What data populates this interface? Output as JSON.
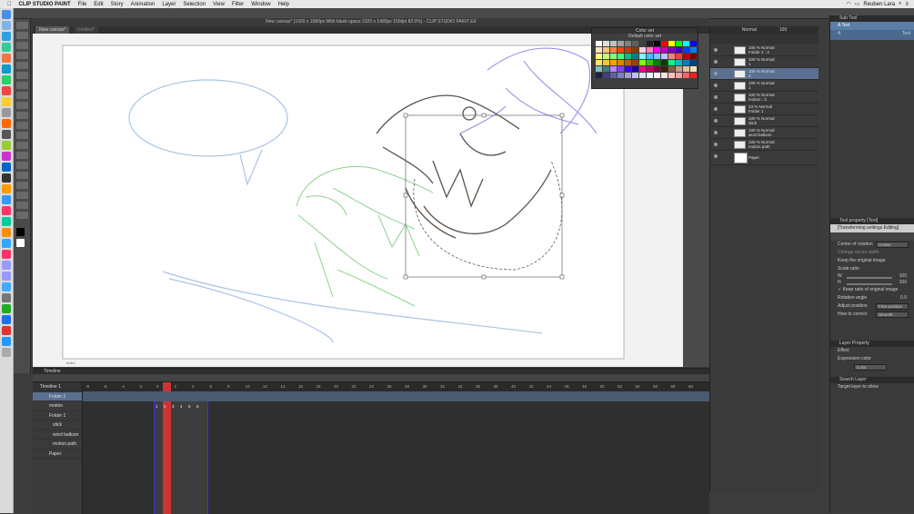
{
  "menubar": {
    "app_name": "CLIP STUDIO PAINT",
    "items": [
      "File",
      "Edit",
      "Story",
      "Animation",
      "Layer",
      "Selection",
      "View",
      "Filter",
      "Window",
      "Help"
    ],
    "user": "Reuben Lara"
  },
  "window": {
    "title": "New canvas* (1920 x 1080px With blank space 2320 x 1480px 150dpi 82.0%)  - CLIP STUDIO PAINT EX",
    "tabs": [
      "New canvas*",
      "Untitled*"
    ]
  },
  "color_set": {
    "title": "Color set",
    "set_name": "Default color set"
  },
  "layers": {
    "blend_mode": "Normal",
    "opacity": "100",
    "rows": [
      {
        "line1": "100 % Normal",
        "line2": "Folder 2 : 3",
        "selected": false
      },
      {
        "line1": "100 % Normal",
        "line2": "1",
        "selected": false
      },
      {
        "line1": "100 % Normal",
        "line2": "3",
        "selected": true
      },
      {
        "line1": "100 % Normal",
        "line2": "1",
        "selected": false
      },
      {
        "line1": "100 % Normal",
        "line2": "motion : 3",
        "selected": false
      },
      {
        "line1": "43 % Normal",
        "line2": "Folder 1",
        "selected": false
      },
      {
        "line1": "100 % Normal",
        "line2": "stick",
        "selected": false
      },
      {
        "line1": "100 % Normal",
        "line2": "word balloon",
        "selected": false
      },
      {
        "line1": "100 % Normal",
        "line2": "motion path",
        "selected": false
      },
      {
        "line1": "",
        "line2": "Paper",
        "selected": false
      }
    ]
  },
  "sub_tool": {
    "header": "Sub Tool",
    "items": [
      "Text"
    ],
    "item2": "Text"
  },
  "tool_property": {
    "header": "Tool property [Text]",
    "mode": "[Transforming settings Editing]",
    "center_of_rotation_label": "Center of rotation",
    "center_of_rotation_value": "Center",
    "change_vector_width": "Change vector width",
    "keep_original_image": "Keep the original image",
    "scale_ratio_label": "Scale ratio",
    "w_label": "W",
    "w_value": "100",
    "h_label": "H",
    "h_value": "100",
    "keep_ratio": "Keep ratio of original image",
    "rotation_label": "Rotation angle",
    "rotation_value": "0.0",
    "adjust_position_label": "Adjust position",
    "adjust_position_value": "Free position",
    "how_to_correct_label": "How to correct",
    "how_to_correct_value": "Smooth"
  },
  "layer_property": {
    "header": "Layer Property",
    "effect_label": "Effect",
    "expression_color_label": "Expression color",
    "expression_color_value": "Color"
  },
  "search_layer": {
    "header": "Search Layer",
    "target_label": "Target layer to show"
  },
  "timeline": {
    "header": "Timeline",
    "name": "Timeline 1",
    "tracks": [
      {
        "name": "Folder 2",
        "selected": true
      },
      {
        "name": "motion",
        "selected": false
      },
      {
        "name": "Folder 1",
        "selected": false
      },
      {
        "name": "stick",
        "selected": false
      },
      {
        "name": "word balloon",
        "selected": false
      },
      {
        "name": "motion path",
        "selected": false
      },
      {
        "name": "Paper",
        "selected": false
      }
    ],
    "frame_labels": [
      "1",
      "2",
      "3",
      "4",
      "5",
      "6"
    ],
    "ruler": [
      "-8",
      "-6",
      "-4",
      "-2",
      "0",
      "2",
      "4",
      "6",
      "8",
      "10",
      "12",
      "14",
      "16",
      "18",
      "20",
      "22",
      "24",
      "26",
      "28",
      "30",
      "32",
      "34",
      "36",
      "38",
      "40",
      "42",
      "44",
      "46",
      "48",
      "50",
      "52",
      "54",
      "56",
      "58",
      "60"
    ]
  },
  "canvas_bottom_label": "Index"
}
